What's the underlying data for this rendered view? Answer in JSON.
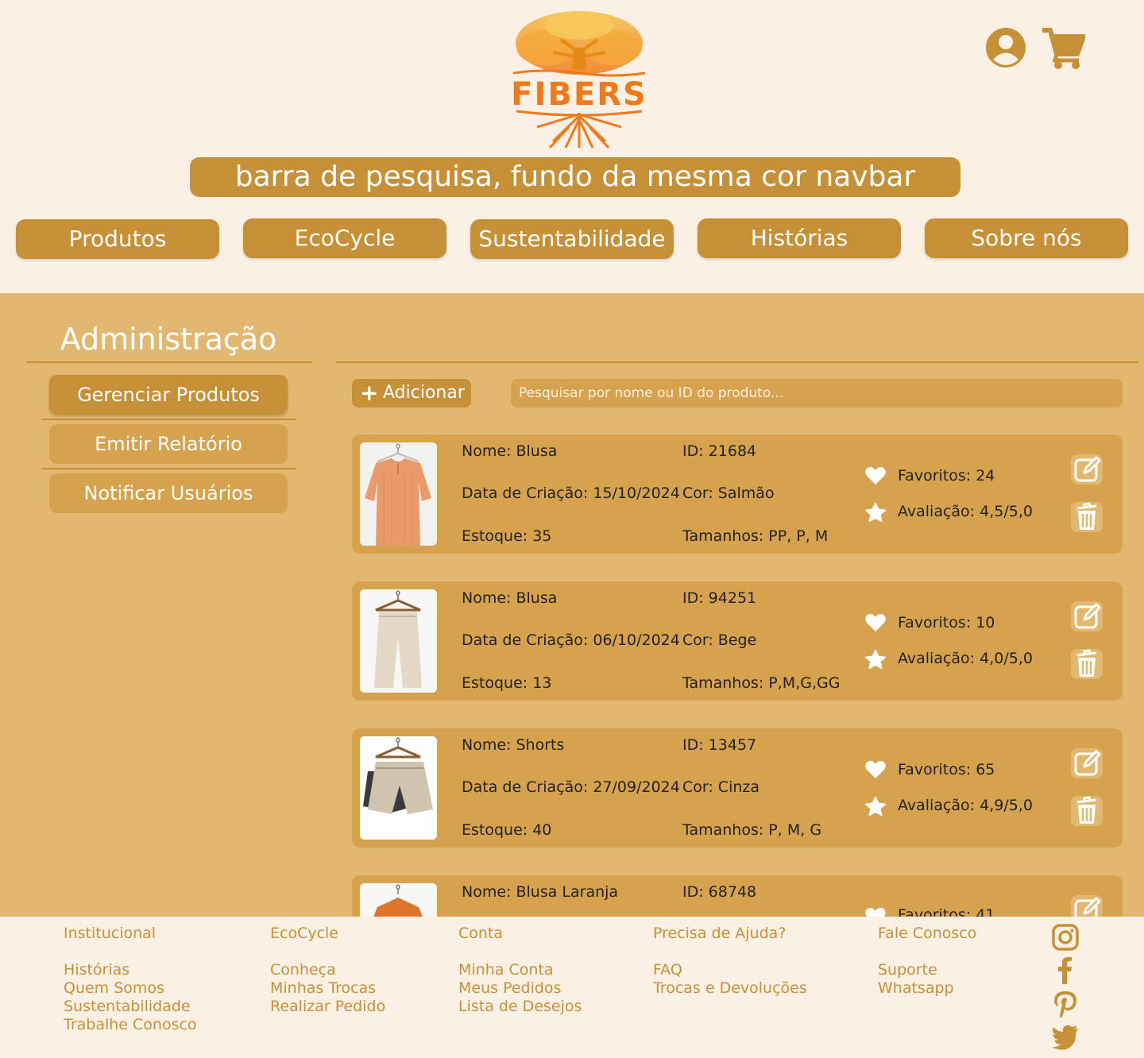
{
  "header": {
    "logo_text": "FIBERS",
    "search_placeholder": "barra de pesquisa, fundo da mesma cor navbar",
    "user_icon": "user-circle-icon",
    "cart_icon": "cart-icon"
  },
  "nav": {
    "items": [
      "Produtos",
      "EcoCycle",
      "Sustentabilidade",
      "Histórias",
      "Sobre nós"
    ]
  },
  "sidebar": {
    "title": "Administração",
    "items": [
      "Gerenciar Produtos",
      "Emitir Relatório",
      "Notificar Usuários"
    ],
    "active_index": 0
  },
  "toolbar": {
    "add_label": "Adicionar",
    "search_placeholder": "Pesquisar por nome ou ID do produto..."
  },
  "products": [
    {
      "name": "Nome: Blusa",
      "id": "ID: 21684",
      "created": "Data de Criação: 15/10/2024",
      "color": "Cor: Salmão",
      "stock": "Estoque: 35",
      "sizes": "Tamanhos: PP, P, M",
      "favorites": "Favoritos: 24",
      "rating": "Avaliação: 4,5/5,0",
      "image": "salmon-blouse"
    },
    {
      "name": "Nome: Blusa",
      "id": "ID: 94251",
      "created": "Data de Criação: 06/10/2024",
      "color": "Cor: Bege",
      "stock": "Estoque: 13",
      "sizes": "Tamanhos: P,M,G,GG",
      "favorites": "Favoritos: 10",
      "rating": "Avaliação: 4,0/5,0",
      "image": "beige-pants"
    },
    {
      "name": "Nome: Shorts",
      "id": "ID: 13457",
      "created": "Data de Criação: 27/09/2024",
      "color": "Cor: Cinza",
      "stock": "Estoque: 40",
      "sizes": "Tamanhos: P, M, G",
      "favorites": "Favoritos: 65",
      "rating": "Avaliação: 4,9/5,0",
      "image": "gray-shorts"
    },
    {
      "name": "Nome: Blusa Laranja",
      "id": "ID: 68748",
      "favorites": "Favoritos: 41",
      "image": "orange-blouse"
    }
  ],
  "footer": {
    "columns": [
      {
        "title": "Institucional",
        "links": [
          "Histórias",
          "Quem Somos",
          "Sustentabilidade",
          "Trabalhe Conosco"
        ]
      },
      {
        "title": "EcoCycle",
        "links": [
          "Conheça",
          "Minhas Trocas",
          "Realizar Pedido"
        ]
      },
      {
        "title": "Conta",
        "links": [
          "Minha Conta",
          "Meus Pedidos",
          "Lista de Desejos"
        ]
      },
      {
        "title": "Precisa de Ajuda?",
        "links": [
          "FAQ",
          "Trocas e Devoluções"
        ]
      },
      {
        "title": "Fale Conosco",
        "links": [
          "Suporte",
          "Whatsapp"
        ]
      }
    ],
    "social": [
      "instagram-icon",
      "facebook-icon",
      "pinterest-icon",
      "twitter-icon"
    ]
  },
  "colors": {
    "page_bg": "#fbf0e4",
    "main_bg": "#e2b870",
    "accent": "#c69136",
    "card_bg": "#d7a24d",
    "logo_orange": "#f07a1a"
  }
}
